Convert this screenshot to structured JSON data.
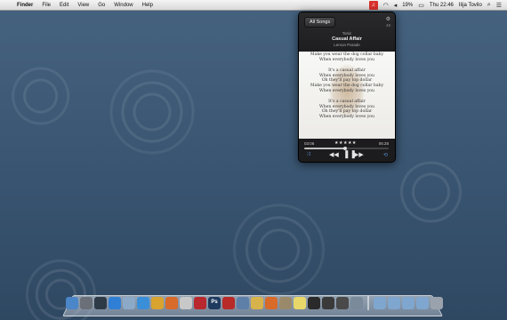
{
  "menubar": {
    "app_name": "Finder",
    "menus": [
      "File",
      "Edit",
      "View",
      "Go",
      "Window",
      "Help"
    ],
    "battery_percent": "19%",
    "clock": "Thu 22:46",
    "user": "Ilija Tovilo"
  },
  "player": {
    "playlist_button": "All Songs",
    "track_count": "48",
    "artist": "Tonic",
    "song_title": "Casual Affair",
    "album": "Lemon Parade",
    "lyrics": [
      "Make you wear the dog collar baby",
      "When everybody loves you",
      "",
      "It's a casual affair",
      "When everybody loves you",
      "Oh they'll pay top dollar",
      "Make you wear the dog collar baby",
      "When everybody loves you",
      "",
      "It's a casual affair",
      "When everybody loves you",
      "Oh they'll pay top dollar",
      "When everybody loves you"
    ],
    "elapsed": "03:06",
    "remaining": "06:28",
    "rating": "★★★★★",
    "progress": 0.48
  },
  "dock": {
    "items": [
      {
        "name": "finder",
        "color": "#4a86c8"
      },
      {
        "name": "launchpad",
        "color": "#6b6f78"
      },
      {
        "name": "mission-control",
        "color": "#2f3a47"
      },
      {
        "name": "app-store",
        "color": "#2f7fd6"
      },
      {
        "name": "mail",
        "color": "#8da9c8"
      },
      {
        "name": "safari",
        "color": "#3b8fd8"
      },
      {
        "name": "chrome",
        "color": "#d9a32f"
      },
      {
        "name": "firefox",
        "color": "#d86a2a"
      },
      {
        "name": "ical",
        "color": "#c8c8c8"
      },
      {
        "name": "music-app",
        "color": "#b8282e"
      },
      {
        "name": "photoshop",
        "color": "#1f3a5f",
        "label": "Ps"
      },
      {
        "name": "flash",
        "color": "#b82a28"
      },
      {
        "name": "xcode",
        "color": "#5d7fa8"
      },
      {
        "name": "pencil",
        "color": "#d8b24a"
      },
      {
        "name": "sparrow",
        "color": "#d86a2a"
      },
      {
        "name": "packages",
        "color": "#9b8a6a"
      },
      {
        "name": "notes",
        "color": "#e8d86a"
      },
      {
        "name": "terminal",
        "color": "#2a2a2a"
      },
      {
        "name": "activity",
        "color": "#3a3a3a"
      },
      {
        "name": "console",
        "color": "#4a4a4a"
      },
      {
        "name": "preview",
        "color": "#7a8a9a"
      },
      {
        "name": "folder-apps",
        "color": "#7fa6cf"
      },
      {
        "name": "folder-docs",
        "color": "#7fa6cf"
      },
      {
        "name": "folder-downloads",
        "color": "#7fa6cf"
      },
      {
        "name": "folder-stack",
        "color": "#7fa6cf"
      },
      {
        "name": "trash",
        "color": "#9aa3ad"
      }
    ]
  }
}
